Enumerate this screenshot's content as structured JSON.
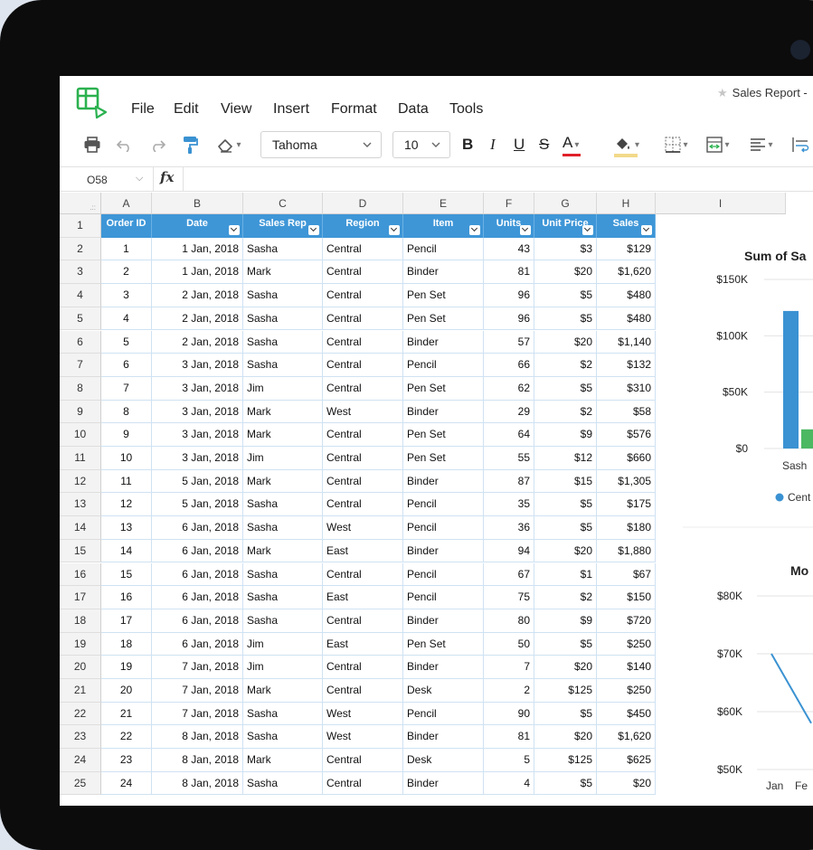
{
  "document": {
    "title": "Sales Report -"
  },
  "menu": [
    "File",
    "Edit",
    "View",
    "Insert",
    "Format",
    "Data",
    "Tools"
  ],
  "toolbar": {
    "font": "Tahoma",
    "font_size": "10",
    "bold": "B",
    "italic": "I",
    "underline": "U",
    "strike": "S",
    "font_color": "A",
    "accent": "#2bb14f",
    "font_color_bar": "#e0202a",
    "fill_color_bar": "#f2d98a"
  },
  "formula_bar": {
    "cell_ref": "O58",
    "fx": "fx"
  },
  "columns": [
    "A",
    "B",
    "C",
    "D",
    "E",
    "F",
    "G",
    "H",
    "I"
  ],
  "header_row": [
    "Order ID",
    "Date",
    "Sales Rep",
    "Region",
    "Item",
    "Units",
    "Unit Price",
    "Sales"
  ],
  "row_numbers": [
    "1",
    "2",
    "3",
    "4",
    "5",
    "6",
    "7",
    "8",
    "9",
    "10",
    "11",
    "12",
    "13",
    "14",
    "15",
    "16",
    "17",
    "18",
    "19",
    "20",
    "21",
    "22",
    "23",
    "24",
    "25"
  ],
  "rows": [
    [
      "1",
      "1 Jan, 2018",
      "Sasha",
      "Central",
      "Pencil",
      "43",
      "$3",
      "$129"
    ],
    [
      "2",
      "1 Jan, 2018",
      "Mark",
      "Central",
      "Binder",
      "81",
      "$20",
      "$1,620"
    ],
    [
      "3",
      "2 Jan, 2018",
      "Sasha",
      "Central",
      "Pen Set",
      "96",
      "$5",
      "$480"
    ],
    [
      "4",
      "2 Jan, 2018",
      "Sasha",
      "Central",
      "Pen Set",
      "96",
      "$5",
      "$480"
    ],
    [
      "5",
      "2 Jan, 2018",
      "Sasha",
      "Central",
      "Binder",
      "57",
      "$20",
      "$1,140"
    ],
    [
      "6",
      "3 Jan, 2018",
      "Sasha",
      "Central",
      "Pencil",
      "66",
      "$2",
      "$132"
    ],
    [
      "7",
      "3 Jan, 2018",
      "Jim",
      "Central",
      "Pen Set",
      "62",
      "$5",
      "$310"
    ],
    [
      "8",
      "3 Jan, 2018",
      "Mark",
      "West",
      "Binder",
      "29",
      "$2",
      "$58"
    ],
    [
      "9",
      "3 Jan, 2018",
      "Mark",
      "Central",
      "Pen Set",
      "64",
      "$9",
      "$576"
    ],
    [
      "10",
      "3 Jan, 2018",
      "Jim",
      "Central",
      "Pen Set",
      "55",
      "$12",
      "$660"
    ],
    [
      "11",
      "5 Jan, 2018",
      "Mark",
      "Central",
      "Binder",
      "87",
      "$15",
      "$1,305"
    ],
    [
      "12",
      "5 Jan, 2018",
      "Sasha",
      "Central",
      "Pencil",
      "35",
      "$5",
      "$175"
    ],
    [
      "13",
      "6 Jan, 2018",
      "Sasha",
      "West",
      "Pencil",
      "36",
      "$5",
      "$180"
    ],
    [
      "14",
      "6 Jan, 2018",
      "Mark",
      "East",
      "Binder",
      "94",
      "$20",
      "$1,880"
    ],
    [
      "15",
      "6 Jan, 2018",
      "Sasha",
      "Central",
      "Pencil",
      "67",
      "$1",
      "$67"
    ],
    [
      "16",
      "6 Jan, 2018",
      "Sasha",
      "East",
      "Pencil",
      "75",
      "$2",
      "$150"
    ],
    [
      "17",
      "6 Jan, 2018",
      "Sasha",
      "Central",
      "Binder",
      "80",
      "$9",
      "$720"
    ],
    [
      "18",
      "6 Jan, 2018",
      "Jim",
      "East",
      "Pen Set",
      "50",
      "$5",
      "$250"
    ],
    [
      "19",
      "7 Jan, 2018",
      "Jim",
      "Central",
      "Binder",
      "7",
      "$20",
      "$140"
    ],
    [
      "20",
      "7 Jan, 2018",
      "Mark",
      "Central",
      "Desk",
      "2",
      "$125",
      "$250"
    ],
    [
      "21",
      "7 Jan, 2018",
      "Sasha",
      "West",
      "Pencil",
      "90",
      "$5",
      "$450"
    ],
    [
      "22",
      "8 Jan, 2018",
      "Sasha",
      "West",
      "Binder",
      "81",
      "$20",
      "$1,620"
    ],
    [
      "23",
      "8 Jan, 2018",
      "Mark",
      "Central",
      "Desk",
      "5",
      "$125",
      "$625"
    ],
    [
      "24",
      "8 Jan, 2018",
      "Sasha",
      "Central",
      "Binder",
      "4",
      "$5",
      "$20"
    ]
  ],
  "chart_data": [
    {
      "type": "bar",
      "title": "Sum of Sa",
      "yticks": [
        "$150K",
        "$100K",
        "$50K",
        "$0"
      ],
      "ylim": [
        0,
        150000
      ],
      "categories": [
        "Sash"
      ],
      "series": [
        {
          "name": "Cent",
          "color": "#3a92d2",
          "values": [
            122000
          ]
        },
        {
          "color": "#4cb862",
          "values": [
            17000
          ]
        }
      ],
      "legend": "bottom"
    },
    {
      "type": "line",
      "title": "Mo",
      "yticks": [
        "$80K",
        "$70K",
        "$60K",
        "$50K"
      ],
      "ylim": [
        50000,
        80000
      ],
      "categories": [
        "Jan",
        "Fe"
      ],
      "series": [
        {
          "color": "#3a92d2",
          "values": [
            70000,
            58000
          ]
        }
      ]
    }
  ]
}
